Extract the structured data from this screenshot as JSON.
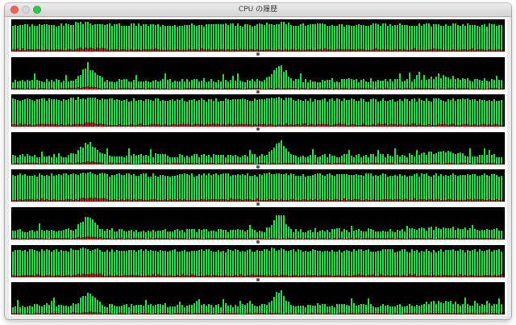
{
  "window": {
    "title": "CPU の履歴",
    "buttons": {
      "close": "close-icon",
      "minimize": "minimize-icon",
      "zoom": "zoom-icon"
    }
  },
  "colors": {
    "graph_background": "#000000",
    "user_load": "#00e63c",
    "system_load": "#e8000b",
    "separator_dot": "#4d4d4d"
  },
  "graphs": [
    {
      "core": 1,
      "pattern": "high"
    },
    {
      "core": 2,
      "pattern": "low"
    },
    {
      "core": 3,
      "pattern": "high"
    },
    {
      "core": 4,
      "pattern": "low"
    },
    {
      "core": 5,
      "pattern": "high"
    },
    {
      "core": 6,
      "pattern": "low"
    },
    {
      "core": 7,
      "pattern": "high"
    },
    {
      "core": 8,
      "pattern": "low"
    }
  ]
}
